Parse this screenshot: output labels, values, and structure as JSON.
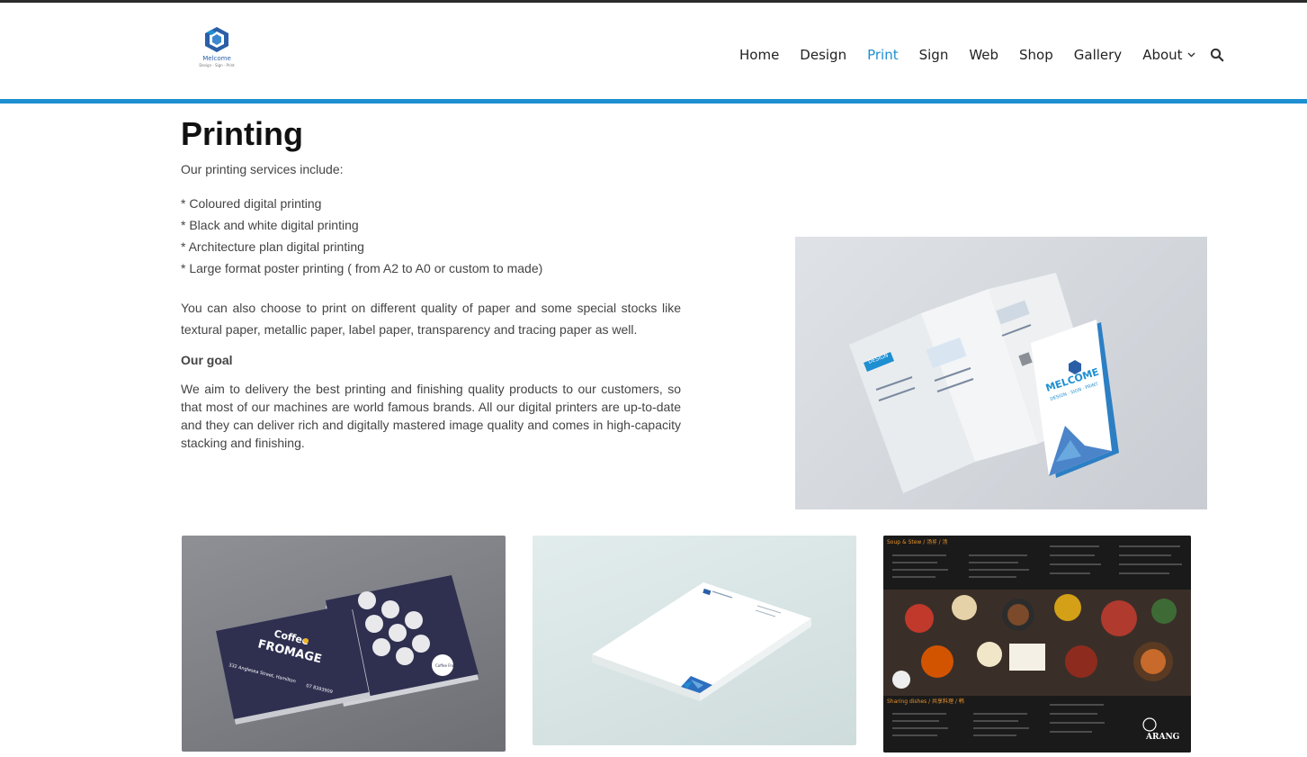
{
  "header": {
    "logo": {
      "word": "Melcome",
      "tagline": "Design · Sign · Print"
    },
    "nav": {
      "home": "Home",
      "design": "Design",
      "print": "Print",
      "sign": "Sign",
      "web": "Web",
      "shop": "Shop",
      "gallery": "Gallery",
      "about": "About"
    },
    "active_item": "Print",
    "accent_color": "#1e8fd1",
    "icons": [
      "chevron-down-icon",
      "search-icon"
    ]
  },
  "main": {
    "title": "Printing",
    "intro": "Our printing services include:",
    "services": [
      "* Coloured digital printing",
      "* Black and white digital printing",
      "* Architecture plan digital printing",
      "* Large format poster printing ( from A2 to A0 or custom to made)"
    ],
    "paper_paragraph": "You can also choose to print on different quality of paper and some special stocks like textural paper, metallic paper, label paper, transparency and tracing paper as well.",
    "goal_heading": "Our goal",
    "goal_paragraph": "We aim to delivery the best printing and finishing quality products to our customers, so that most of our machines are world famous brands. All our digital printers are up-to-date and they can deliver rich and digitally mastered image quality and comes in high-capacity stacking and finishing."
  },
  "images": {
    "brochure": {
      "brand": "MELCOME",
      "brand_sub": "DESIGN · SIGN · PRINT",
      "panel_label": "DESIGN"
    },
    "business_card": {
      "brand_line1": "Coffee",
      "brand_line2": "FROMAGE",
      "address": "332 Anglesea Street, Hamilton",
      "phone": "07 8393909",
      "stamp": "Coffee Fromage"
    },
    "letterhead": {},
    "menu": {
      "section_top": "Soup & Stew / 汤류 / 汤",
      "section_bottom": "Sharing dishes / 共享料理 / 韩",
      "brand": "ARANG"
    }
  }
}
